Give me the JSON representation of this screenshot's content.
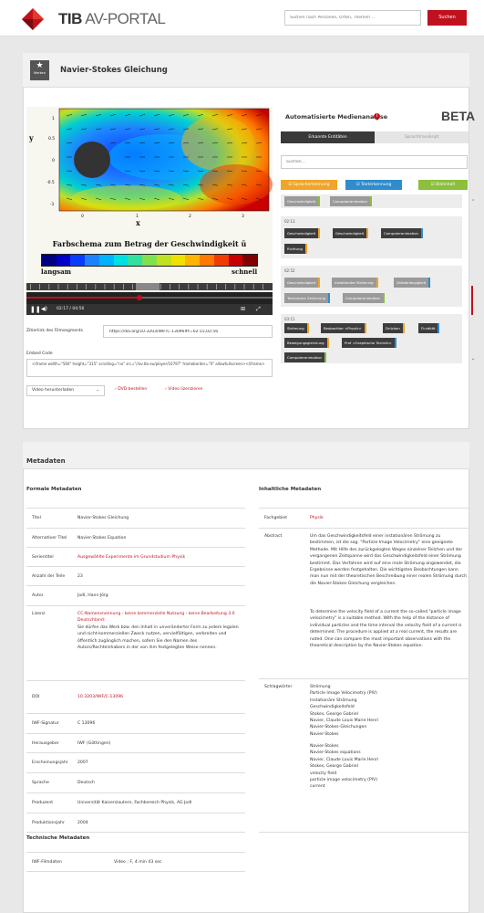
{
  "header": {
    "brand_bold": "TIB",
    "brand_rest": "AV-PORTAL",
    "search_placeholder": "Suchen nach Personen, Orten, Themen ...",
    "search_button": "Suchen"
  },
  "video_title": {
    "merken_label": "Merken",
    "title": "Navier-Stokes Gleichung"
  },
  "player": {
    "caption": "Farbschema zum Betrag der Geschwindigkeit",
    "caption_symbol": "ū",
    "low_label": "langsam",
    "high_label": "schnell",
    "y_axis": "y",
    "x_axis": "x",
    "y_ticks": [
      "1",
      "0.5",
      "0",
      "-0.5",
      "-1"
    ],
    "x_ticks": [
      "0",
      "1",
      "2",
      "3"
    ],
    "time": "02:17 / 04:56",
    "progress": 0.46,
    "colors": [
      "#000080",
      "#0000c8",
      "#0a3cff",
      "#1e82ff",
      "#00b4ff",
      "#00e0e0",
      "#32e0a0",
      "#80e050",
      "#c0e020",
      "#f0e000",
      "#ffb400",
      "#ff7800",
      "#f03c00",
      "#c80000",
      "#800000"
    ]
  },
  "zitier": {
    "label": "Zitierlink des Filmsegments",
    "value": "https://doi.org/10.3203/IWF/C-13096#t=02:15,02:56"
  },
  "embed": {
    "label": "Embed Code",
    "value": "<iframe width=\"560\" height=\"315\" scrolling=\"no\" src=\"//av.tib.eu/player/10797\" frameborder=\"0\" allowfullscreen></iframe>"
  },
  "actions": {
    "download": "Video herunterladen",
    "dvd": "DVD bestellen",
    "license": "Video lizenzieren"
  },
  "analysis": {
    "title": "Automatisierte Medienanalyse",
    "beta": "BETA",
    "tab_entities": "Erkannte Entitäten",
    "tab_transcript": "Sprachtranskript",
    "search_placeholder": "Suchen...",
    "filter_speech": "☑ Spracherkennung",
    "filter_text": "☑ Texterkennung",
    "filter_image": "☑ Bildinhalt",
    "segments": [
      {
        "time": "",
        "tags": [
          "Geschwindigkeit",
          "Computeranimation"
        ]
      },
      {
        "time": "02:13",
        "tags": [
          "Geschwindigkeit",
          "Geschwindigkeit",
          "Computeranimation",
          "Richtung"
        ]
      },
      {
        "time": "02:52",
        "tags": [
          "Geschwindigkeit",
          "Instationäre Strömung",
          "Zeitabhängigkeit",
          "Technische Zeichnung",
          "Computeranimation"
        ]
      },
      {
        "time": "03:11",
        "tags": [
          "Strömung",
          "Beobachter <Physik>",
          "Drücken",
          "Fluidität",
          "Bewegungsgleichung",
          "Prof <Graphische Technik>",
          "Computeranimation"
        ]
      }
    ]
  },
  "metadata": {
    "title": "Metadaten",
    "formal_title": "Formale Metadaten",
    "content_title": "Inhaltliche Metadaten",
    "tech_title": "Technische Metadaten",
    "formal": [
      {
        "k": "Titel",
        "v": "Navier-Stokes Gleichung"
      },
      {
        "k": "Alternativer Titel",
        "v": "Navier-Stokes Equation"
      },
      {
        "k": "Serientitel",
        "v": "Ausgewählte Experimente im Grundstudium Physik"
      },
      {
        "k": "Anzahl der Teile",
        "v": "23"
      },
      {
        "k": "Autor",
        "v": "Jodl, Hans-Jörg"
      },
      {
        "k": "Lizenz",
        "v1": "CC-Namensnennung - keine kommerzielle Nutzung - keine Bearbeitung 3.0 Deutschland:",
        "v2": "Sie dürfen das Werk bzw. den Inhalt in unveränderter Form zu jedem legalen und nicht-kommerziellen Zweck nutzen, vervielfältigen, verbreiten und öffentlich zugänglich machen, sofern Sie den Namen des Autors/Rechteinhabers in der von ihm festgelegten Weise nennen."
      },
      {
        "k": "DOI",
        "v": "10.3203/IWF/C-13096"
      },
      {
        "k": "IWF-Signatur",
        "v": "C 13096"
      },
      {
        "k": "Herausgeber",
        "v": "IWF (Göttingen)"
      },
      {
        "k": "Erscheinungsjahr",
        "v": "2007"
      },
      {
        "k": "Sprache",
        "v": "Deutsch"
      },
      {
        "k": "Produzent",
        "v": "Universität Kaiserslautern, Fachbereich Physik, AG Jodl"
      },
      {
        "k": "Produktionsjahr",
        "v": "2004"
      }
    ],
    "fachgebiet_k": "Fachgebiet",
    "fachgebiet_v": "Physik",
    "abstract_k": "Abstract",
    "abstract_de": "Um das Geschwindigkeitsfeld einer instationären Strömung zu bestimmen, ist die sog. \"Particle Image Velocimetry\" eine geeignete Methode. Mit Hilfe des zurückgelegten Weges einzelner Teilchen und der vergangenen Zeitspanne wird das Geschwindigkeitsfeld einer Strömung bestimmt. Das Verfahren wird auf eine reale Strömung angewendet, die Ergebnisse werden festgehalten. Die wichtigsten Beobachtungen kann man nun mit der theoretischen Beschreibung einer realen Strömung durch die Navier-Stokes-Gleichung vergleichen.",
    "abstract_en": "To determine the velocity field of a current the so-called \"particle image velocimetry\" is a suitable method. With the help of the distance of individual particles and the time interval the velocity field of a current is determined. The procedure is applied at a real current, the results are noted. One can compare the most important observations with the theoretical description by the Navier-Stokes equation.",
    "keywords_k": "Schlagwörter",
    "keywords_de": [
      "Strömung",
      "Particle Image Velocimetry (PIV)",
      "Instationäre Strömung",
      "Geschwindigkeitsfeld",
      "Stokes, George Gabriel",
      "Navier, Claude Louis Marie Henri",
      "Navier-Stokes-Gleichungen",
      "Navier-Stokes"
    ],
    "keywords_en": [
      "Navier-Stokes",
      "Navier-Stokes equations",
      "Navier, Claude Louis Marie Henri",
      "Stokes, George Gabriel",
      "velocity field",
      "particle image velocimetry (PIV)",
      "current"
    ],
    "tech_k": "IWF-Filmdaten",
    "tech_v": "Video ; F, 4 min 43 sec"
  }
}
